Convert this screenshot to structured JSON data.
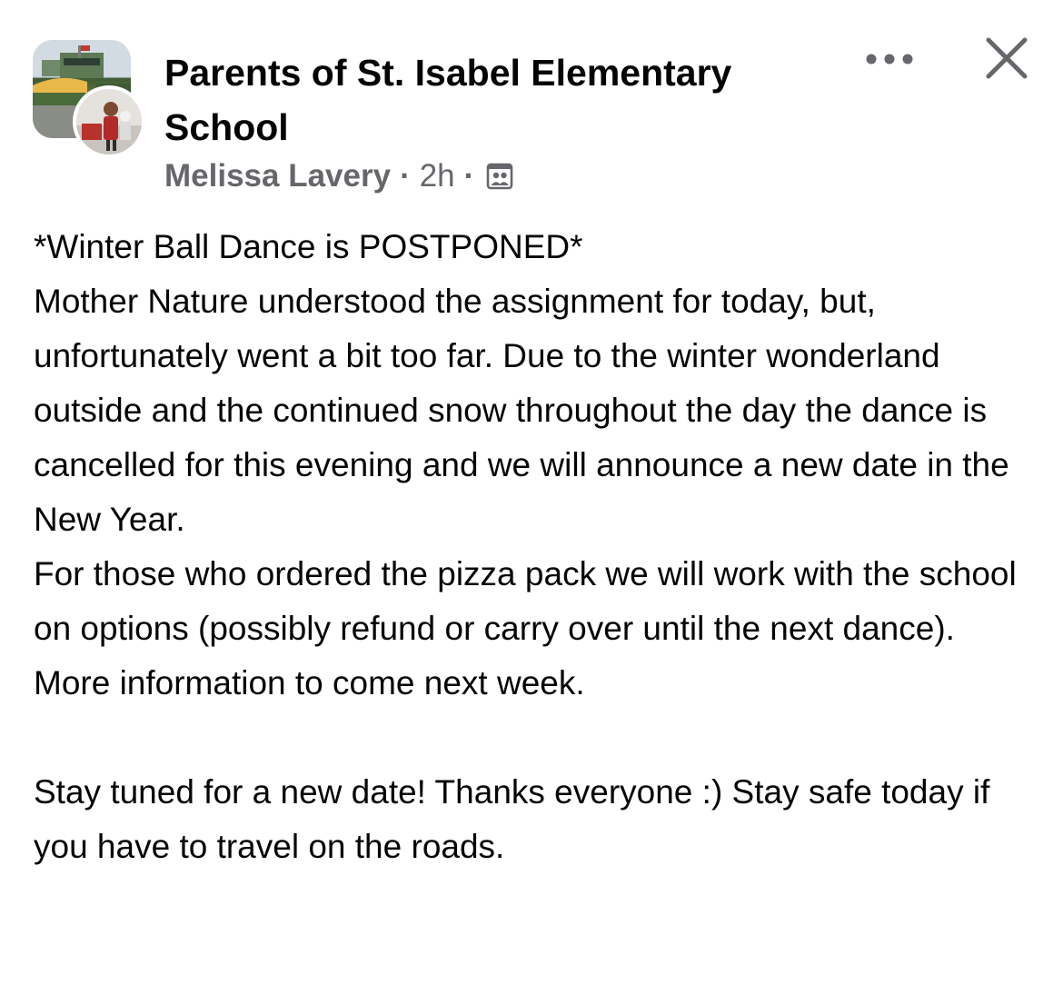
{
  "post": {
    "group_name": "Parents of St. Isabel Elementary School",
    "author": "Melissa Lavery",
    "separator": "·",
    "time": "2h",
    "audience_icon": "members-icon",
    "more_icon": "more-horizontal-icon",
    "close_icon": "close-icon",
    "body": {
      "heading": "*Winter Ball Dance is POSTPONED*",
      "paragraph1": "Mother Nature understood the assignment for today, but, unfortunately went a bit too far. Due to the winter wonderland outside and the continued snow throughout the day the dance is cancelled for this evening and we will announce a new date in the New Year.",
      "paragraph2": "For those who ordered the pizza pack we will work with the school on options (possibly refund or carry over until the next dance). More information to come next week.",
      "paragraph3": "Stay tuned for a new date! Thanks everyone :) Stay safe today if you have to travel on the roads."
    }
  },
  "colors": {
    "text_primary": "#050505",
    "text_secondary": "#65676b",
    "background": "#ffffff"
  }
}
